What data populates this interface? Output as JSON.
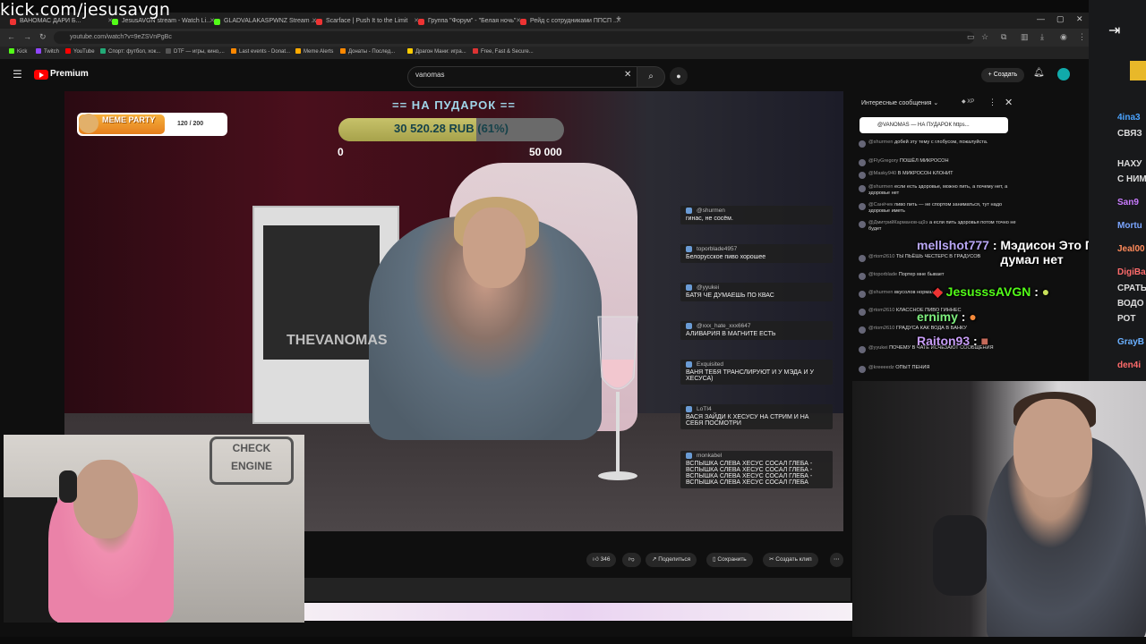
{
  "overlay_url": "kick.com/jesusavgn",
  "browser": {
    "tabs": [
      {
        "label": "ВАНОМАС ДАРИ Б...",
        "color": "#e33"
      },
      {
        "label": "JesusAVGN stream - Watch Li...",
        "color": "#53fc18"
      },
      {
        "label": "GLADVALAKASPWNZ Stream ...",
        "color": "#53fc18"
      },
      {
        "label": "Scarface | Push It to the Limit",
        "color": "#e33"
      },
      {
        "label": "Группа \"Форум\" - \"Белая ночь\"",
        "color": "#e33"
      },
      {
        "label": "Рейд с сотрудниками ППСП ...",
        "color": "#e33"
      }
    ],
    "newtab_icon": "plus-icon",
    "address": "youtube.com/watch?v=9eZSVnPgBc",
    "bookmarks": [
      {
        "label": "Kick",
        "color": "#53fc18"
      },
      {
        "label": "Twitch",
        "color": "#9146ff"
      },
      {
        "label": "YouTube",
        "color": "#f00"
      },
      {
        "label": "Спорт: футбол, хок...",
        "color": "#2a7"
      },
      {
        "label": "DTF — игры, кино,...",
        "color": "#333"
      },
      {
        "label": "Last events - Donat...",
        "color": "#f80"
      },
      {
        "label": "Meme Alerts",
        "color": "#fa0"
      },
      {
        "label": "Донаты - Послед...",
        "color": "#f80"
      },
      {
        "label": "Драгон Мани: игра...",
        "color": "#fc0"
      },
      {
        "label": "Free, Fast & Secure...",
        "color": "#d33"
      }
    ]
  },
  "youtube": {
    "logo_text": "Premium",
    "search_value": "vanomas",
    "create_label": "+ Создать"
  },
  "video": {
    "goal_title": "== НА ПУДАРОК ==",
    "goal_amount": "30 520.28 RUB (61%)",
    "goal_progress": 0.61,
    "goal_min": "0",
    "goal_max": "50 000",
    "meme_party_label": "MEME PARTY",
    "meme_party_count": "120 / 200",
    "meme_party_progress": 0.6,
    "watermark": "THEVANOMAS",
    "chat": [
      {
        "user": "@shurmen",
        "msg": "гинас, не сосём."
      },
      {
        "user": "toporblade4957",
        "msg": "Белорусское пиво хорошее"
      },
      {
        "user": "@yyukei",
        "msg": "БАТЯ ЧЕ ДУМАЕШЬ ПО КВАС"
      },
      {
        "user": "@xxx_hate_xxx6647",
        "msg": "АЛИВАРИЯ В МАГНИТЕ ЕСТЬ"
      },
      {
        "user": "Exquisited",
        "msg": "ВАНЯ ТЕБЯ ТРАНСЛИРУЮТ И У МЭДА И У ХЕСУСА)"
      },
      {
        "user": "LoTI4",
        "msg": "ВАСЯ ЗАЙДИ К ХЕСУСУ НА СТРИМ И НА СЕБЯ ПОСМОТРИ"
      },
      {
        "user": "monkabel",
        "msg": "ВСПЫШКА СЛЕВА ХЕСУС СОСАЛ ГЛЕБА - ВСПЫШКА СЛЕВА ХЕСУС СОСАЛ ГЛЕБА - ВСПЫШКА СЛЕВА ХЕСУС СОСАЛ ГЛЕБА - ВСПЫШКА СЛЕВА ХЕСУС СОСАЛ ГЛЕБА"
      }
    ],
    "actions": {
      "likes": "346",
      "share": "Поделиться",
      "save": "Сохранить",
      "clip": "Создать клип"
    }
  },
  "ytchat": {
    "title": "Интересные сообщения",
    "pinned": "@VANOMAS — НА ПУДАРОК https...",
    "messages": [
      {
        "user": "@shurmen",
        "msg": "добей эту тему с глобусом, пожалуйста."
      },
      {
        "user": "@FlyGregory",
        "msg": "ПОШЁЛ МИКРОСОН"
      },
      {
        "user": "@Masky940",
        "msg": "В МИКРОСОН КЛОНИТ"
      },
      {
        "user": "@shurmen",
        "msg": "если есть здоровье, можно пить, а почему нет, а здоровье нет"
      },
      {
        "user": "@Санёчек",
        "msg": "пиво пить — не спортом заниматься, тут надо здоровье иметь"
      },
      {
        "user": "@ДмитрийКарманов-щ9э",
        "msg": "а если пить здоровья потом точно не будет"
      },
      {
        "user": "@rtom2610",
        "msg": "ТЫ ПЬЁШЬ ЧЕСТЕРС В ГРАДУСОВ"
      },
      {
        "user": "@toporblade",
        "msg": "Портер мне бывает"
      },
      {
        "user": "@shurmen",
        "msg": "вкусолов нормально"
      },
      {
        "user": "@rtom2610",
        "msg": "КЛАССНОЕ ПИВО ГИННЕС"
      },
      {
        "user": "@rtom2610",
        "msg": "ГРАДУСА КАК ВОДА В БАНКУ"
      },
      {
        "user": "@yyukei",
        "msg": "ПОЧЕМУ В ЧАТЕ ИСЧЕЗАЮТ СООБЩЕНИЯ"
      },
      {
        "user": "@kreeeedz",
        "msg": "ОПЫТ ПЕНИЯ"
      }
    ]
  },
  "kick_chat": [
    {
      "user": "mellshot777",
      "text": "Мэдисон Это Пидорас да ? я думал нет",
      "color": "#b9a7f5"
    },
    {
      "user": "JesusssAVGN",
      "text": "",
      "color": "#53fc18"
    },
    {
      "user": "ernimy",
      "text": "",
      "color": "#7ef07e"
    },
    {
      "user": "Raiton93",
      "text": "",
      "color": "#c79cf5"
    }
  ],
  "kick_sidebar": [
    {
      "text": "4ina3",
      "color": "#4aa3ff"
    },
    {
      "text": "СВЯЗ",
      "color": "#ddd"
    },
    {
      "text": "НАХУ",
      "color": "#ddd"
    },
    {
      "text": "С НИМ",
      "color": "#ddd"
    },
    {
      "text": "San9",
      "color": "#c97bff"
    },
    {
      "text": "Mortu",
      "color": "#7aa5ff"
    },
    {
      "text": "Jeal00",
      "color": "#ff8a5a"
    },
    {
      "text": "DigiBa",
      "color": "#ff6b6b"
    },
    {
      "text": "СРАТЬ",
      "color": "#ddd"
    },
    {
      "text": "ВОДО",
      "color": "#ddd"
    },
    {
      "text": "РОТ",
      "color": "#ddd"
    },
    {
      "text": "GrayB",
      "color": "#6ab0ff"
    },
    {
      "text": "den4i",
      "color": "#ff6b6b"
    }
  ],
  "cam_left_sign": "CHECK ENGINE"
}
